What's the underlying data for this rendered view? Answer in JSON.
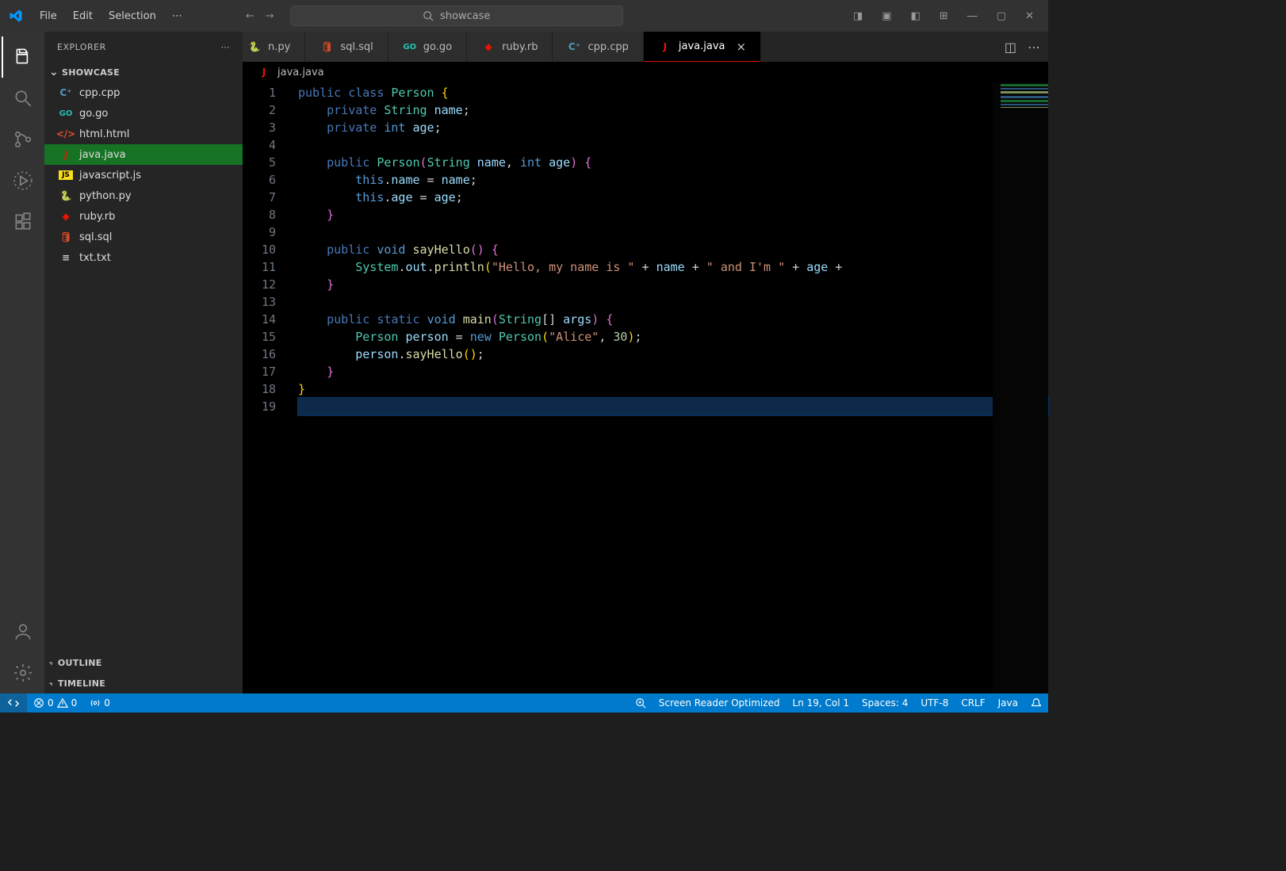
{
  "menu": {
    "file": "File",
    "edit": "Edit",
    "selection": "Selection",
    "more": "⋯"
  },
  "search_placeholder": "showcase",
  "explorer": {
    "title": "EXPLORER",
    "section": "SHOWCASE",
    "outline": "OUTLINE",
    "timeline": "TIMELINE"
  },
  "files": [
    {
      "icon": "cpp",
      "name": "cpp.cpp"
    },
    {
      "icon": "go",
      "name": "go.go"
    },
    {
      "icon": "html",
      "name": "html.html"
    },
    {
      "icon": "j",
      "name": "java.java",
      "selected": true
    },
    {
      "icon": "js",
      "name": "javascript.js"
    },
    {
      "icon": "py",
      "name": "python.py"
    },
    {
      "icon": "rb",
      "name": "ruby.rb"
    },
    {
      "icon": "sql",
      "name": "sql.sql"
    },
    {
      "icon": "txt",
      "name": "txt.txt"
    }
  ],
  "tabs": [
    {
      "icon": "py",
      "label": "n.py",
      "partial": true
    },
    {
      "icon": "sql",
      "label": "sql.sql"
    },
    {
      "icon": "go",
      "label": "go.go"
    },
    {
      "icon": "rb",
      "label": "ruby.rb"
    },
    {
      "icon": "cpp",
      "label": "cpp.cpp"
    },
    {
      "icon": "j",
      "label": "java.java",
      "active": true,
      "closable": true
    }
  ],
  "breadcrumb": {
    "icon": "j",
    "label": "java.java"
  },
  "code": {
    "lines": [
      [
        {
          "t": "public",
          "c": "kw"
        },
        {
          "t": " "
        },
        {
          "t": "class",
          "c": "kw"
        },
        {
          "t": " "
        },
        {
          "t": "Person",
          "c": "type"
        },
        {
          "t": " "
        },
        {
          "t": "{",
          "c": "brc"
        }
      ],
      [
        {
          "t": "    "
        },
        {
          "t": "private",
          "c": "kw"
        },
        {
          "t": " "
        },
        {
          "t": "String",
          "c": "type"
        },
        {
          "t": " "
        },
        {
          "t": "name",
          "c": "var"
        },
        {
          "t": ";",
          "c": "pun"
        }
      ],
      [
        {
          "t": "    "
        },
        {
          "t": "private",
          "c": "kw"
        },
        {
          "t": " "
        },
        {
          "t": "int",
          "c": "kw2"
        },
        {
          "t": " "
        },
        {
          "t": "age",
          "c": "var"
        },
        {
          "t": ";",
          "c": "pun"
        }
      ],
      [],
      [
        {
          "t": "    "
        },
        {
          "t": "public",
          "c": "kw"
        },
        {
          "t": " "
        },
        {
          "t": "Person",
          "c": "type"
        },
        {
          "t": "(",
          "c": "brc2"
        },
        {
          "t": "String",
          "c": "type"
        },
        {
          "t": " "
        },
        {
          "t": "name",
          "c": "var"
        },
        {
          "t": ", ",
          "c": "pun"
        },
        {
          "t": "int",
          "c": "kw2"
        },
        {
          "t": " "
        },
        {
          "t": "age",
          "c": "var"
        },
        {
          "t": ")",
          "c": "brc2"
        },
        {
          "t": " "
        },
        {
          "t": "{",
          "c": "brc2"
        }
      ],
      [
        {
          "t": "        "
        },
        {
          "t": "this",
          "c": "kw2"
        },
        {
          "t": ".",
          "c": "pun"
        },
        {
          "t": "name",
          "c": "var"
        },
        {
          "t": " = ",
          "c": "pun"
        },
        {
          "t": "name",
          "c": "var"
        },
        {
          "t": ";",
          "c": "pun"
        }
      ],
      [
        {
          "t": "        "
        },
        {
          "t": "this",
          "c": "kw2"
        },
        {
          "t": ".",
          "c": "pun"
        },
        {
          "t": "age",
          "c": "var"
        },
        {
          "t": " = ",
          "c": "pun"
        },
        {
          "t": "age",
          "c": "var"
        },
        {
          "t": ";",
          "c": "pun"
        }
      ],
      [
        {
          "t": "    "
        },
        {
          "t": "}",
          "c": "brc2"
        }
      ],
      [],
      [
        {
          "t": "    "
        },
        {
          "t": "public",
          "c": "kw"
        },
        {
          "t": " "
        },
        {
          "t": "void",
          "c": "kw2"
        },
        {
          "t": " "
        },
        {
          "t": "sayHello",
          "c": "fn"
        },
        {
          "t": "()",
          "c": "brc2"
        },
        {
          "t": " "
        },
        {
          "t": "{",
          "c": "brc2"
        }
      ],
      [
        {
          "t": "        "
        },
        {
          "t": "System",
          "c": "type"
        },
        {
          "t": ".",
          "c": "pun"
        },
        {
          "t": "out",
          "c": "var"
        },
        {
          "t": ".",
          "c": "pun"
        },
        {
          "t": "println",
          "c": "fn"
        },
        {
          "t": "(",
          "c": "brc"
        },
        {
          "t": "\"Hello, my name is \"",
          "c": "str"
        },
        {
          "t": " + ",
          "c": "pun"
        },
        {
          "t": "name",
          "c": "var"
        },
        {
          "t": " + ",
          "c": "pun"
        },
        {
          "t": "\" and I'm \"",
          "c": "str"
        },
        {
          "t": " + ",
          "c": "pun"
        },
        {
          "t": "age",
          "c": "var"
        },
        {
          "t": " + ",
          "c": "pun"
        }
      ],
      [
        {
          "t": "    "
        },
        {
          "t": "}",
          "c": "brc2"
        }
      ],
      [],
      [
        {
          "t": "    "
        },
        {
          "t": "public",
          "c": "kw"
        },
        {
          "t": " "
        },
        {
          "t": "static",
          "c": "kw"
        },
        {
          "t": " "
        },
        {
          "t": "void",
          "c": "kw2"
        },
        {
          "t": " "
        },
        {
          "t": "main",
          "c": "fn"
        },
        {
          "t": "(",
          "c": "brc2"
        },
        {
          "t": "String",
          "c": "type"
        },
        {
          "t": "[] ",
          "c": "pun"
        },
        {
          "t": "args",
          "c": "var"
        },
        {
          "t": ")",
          "c": "brc2"
        },
        {
          "t": " "
        },
        {
          "t": "{",
          "c": "brc2"
        }
      ],
      [
        {
          "t": "        "
        },
        {
          "t": "Person",
          "c": "type"
        },
        {
          "t": " "
        },
        {
          "t": "person",
          "c": "var"
        },
        {
          "t": " = ",
          "c": "pun"
        },
        {
          "t": "new",
          "c": "kw2"
        },
        {
          "t": " "
        },
        {
          "t": "Person",
          "c": "type"
        },
        {
          "t": "(",
          "c": "brc"
        },
        {
          "t": "\"Alice\"",
          "c": "str"
        },
        {
          "t": ", ",
          "c": "pun"
        },
        {
          "t": "30",
          "c": "num"
        },
        {
          "t": ")",
          "c": "brc"
        },
        {
          "t": ";",
          "c": "pun"
        }
      ],
      [
        {
          "t": "        "
        },
        {
          "t": "person",
          "c": "var"
        },
        {
          "t": ".",
          "c": "pun"
        },
        {
          "t": "sayHello",
          "c": "fn"
        },
        {
          "t": "()",
          "c": "brc"
        },
        {
          "t": ";",
          "c": "pun"
        }
      ],
      [
        {
          "t": "    "
        },
        {
          "t": "}",
          "c": "brc2"
        }
      ],
      [
        {
          "t": "}",
          "c": "brc"
        }
      ],
      []
    ],
    "current_line": 19
  },
  "status": {
    "errors": "0",
    "warnings": "0",
    "ports": "0",
    "screen_reader": "Screen Reader Optimized",
    "cursor": "Ln 19, Col 1",
    "spaces": "Spaces: 4",
    "encoding": "UTF-8",
    "eol": "CRLF",
    "lang": "Java"
  }
}
